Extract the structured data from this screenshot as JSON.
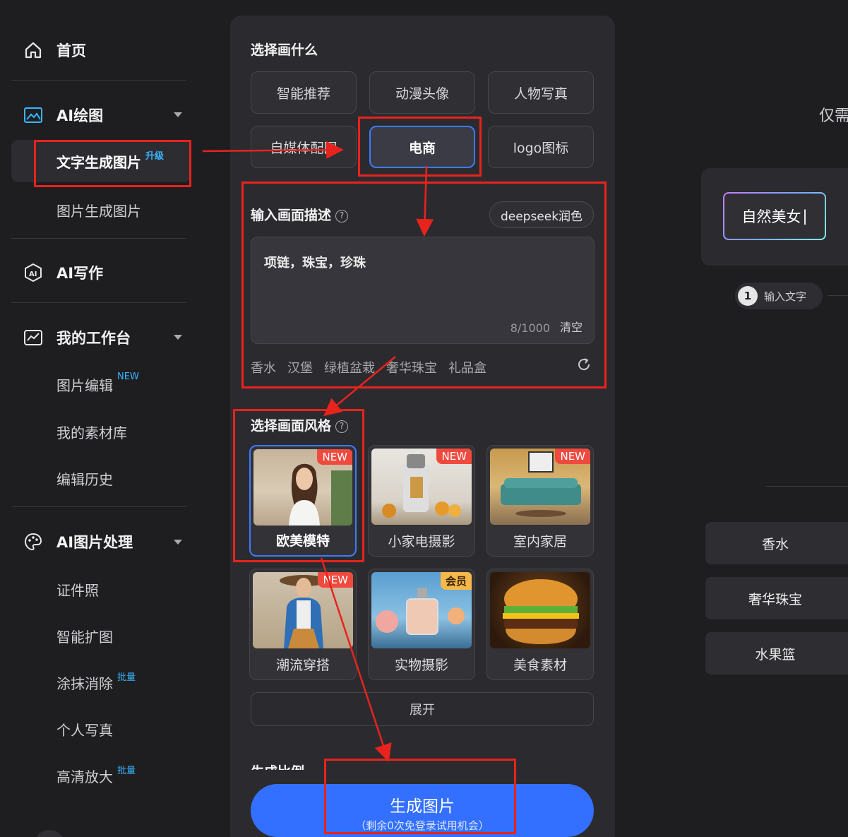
{
  "sidebar": {
    "home": "首页",
    "ai_draw": "AI绘图",
    "text_to_image": "文字生成图片",
    "upgrade_badge": "升级",
    "image_to_image": "图片生成图片",
    "ai_write": "AI写作",
    "workspace": "我的工作台",
    "image_edit": "图片编辑",
    "new_badge": "NEW",
    "materials": "我的素材库",
    "history": "编辑历史",
    "ai_image_process": "AI图片处理",
    "id_photo": "证件照",
    "smart_expand": "智能扩图",
    "erase": "涂抹消除",
    "batch_badge": "批量",
    "portrait": "个人写真",
    "hd_upscale": "高清放大"
  },
  "panel": {
    "choose_what": "选择画什么",
    "categories": [
      "智能推荐",
      "动漫头像",
      "人物写真",
      "自媒体配图",
      "电商",
      "logo图标"
    ],
    "describe_title": "输入画面描述",
    "help": "?",
    "deepseek": "deepseek润色",
    "prompt_value": "项链，珠宝，珍珠",
    "counter": "8/1000",
    "clear": "清空",
    "tags": [
      "香水",
      "汉堡",
      "绿植盆栽",
      "奢华珠宝",
      "礼品盒"
    ],
    "style_title": "选择画面风格",
    "styles": [
      {
        "label": "欧美模特",
        "badge": "NEW"
      },
      {
        "label": "小家电摄影",
        "badge": "NEW"
      },
      {
        "label": "室内家居",
        "badge": "NEW"
      },
      {
        "label": "潮流穿搭",
        "badge": "NEW"
      },
      {
        "label": "实物摄影",
        "badge": "会员"
      },
      {
        "label": "美食素材",
        "badge": ""
      }
    ],
    "expand": "展开",
    "ratio_title": "生成比例",
    "generate": "生成图片",
    "generate_sub": "（剩余0次免登录试用机会）"
  },
  "preview": {
    "cut_text": "仅需",
    "input_text": "自然美女",
    "step_num": "1",
    "step_label": "输入文字",
    "suggestions": [
      "香水",
      "奢华珠宝",
      "水果篮"
    ]
  },
  "colors": {
    "accent": "#3470ff",
    "annotation": "#e8231d",
    "new_badge": "#f04a3e",
    "vip_badge": "#f5b94a",
    "sup_text": "#38b6ff"
  }
}
